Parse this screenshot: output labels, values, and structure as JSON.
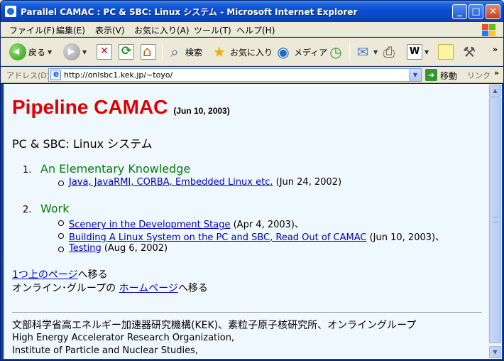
{
  "window": {
    "title": "Parallel CAMAC : PC & SBC: Linux システム - Microsoft Internet Explorer",
    "minimize": "_",
    "maximize": "□",
    "close": "✕"
  },
  "menu": [
    "ファイル(F)",
    "編集(E)",
    "表示(V)",
    "お気に入り(A)",
    "ツール(T)",
    "ヘルプ(H)"
  ],
  "toolbar": {
    "back": "戻る",
    "search": "検索",
    "favorites": "お気に入り",
    "media": "メディア"
  },
  "address": {
    "label": "アドレス(D)",
    "url": "http://onlsbc1.kek.jp/~toyo/",
    "go": "移動",
    "links": "リンク"
  },
  "page": {
    "title": "Pipeline CAMAC",
    "title_date": "(Jun 10, 2003)",
    "subtitle": "PC & SBC: Linux システム",
    "sections": [
      {
        "number": "1.",
        "heading": "An Elementary Knowledge",
        "items": [
          {
            "link": "Java, JavaRMI, CORBA, Embedded Linux etc.",
            "suffix": " (Jun 24, 2002)"
          }
        ]
      },
      {
        "number": "2.",
        "heading": "Work",
        "items": [
          {
            "link": "Scenery in the Development Stage",
            "suffix": " (Apr 4, 2003)、"
          },
          {
            "link": "Building A Linux System on the PC and SBC, Read Out of CAMAC",
            "suffix": " (Jun 10, 2003)、"
          },
          {
            "link": "Testing",
            "suffix": " (Aug 6, 2002)"
          }
        ]
      }
    ],
    "nav1_link": "1つ上のページ",
    "nav1_suffix": "へ移る",
    "nav2_prefix": "オンライン･グループの ",
    "nav2_link": "ホームページ",
    "nav2_suffix": "へ移る",
    "footer_jp": "文部科学省高エネルギー加速器研究機構(KEK)、素粒子原子核研究所、オンライングループ",
    "footer_en1": "High Energy Accelerator Research Organization,",
    "footer_en2": "Institute of Particle and Nuclear Studies,"
  },
  "colors": {
    "title_red": "#e00000",
    "heading_green": "#008000",
    "link_blue": "#0000c0",
    "content_bg": "#f0f8ff"
  }
}
